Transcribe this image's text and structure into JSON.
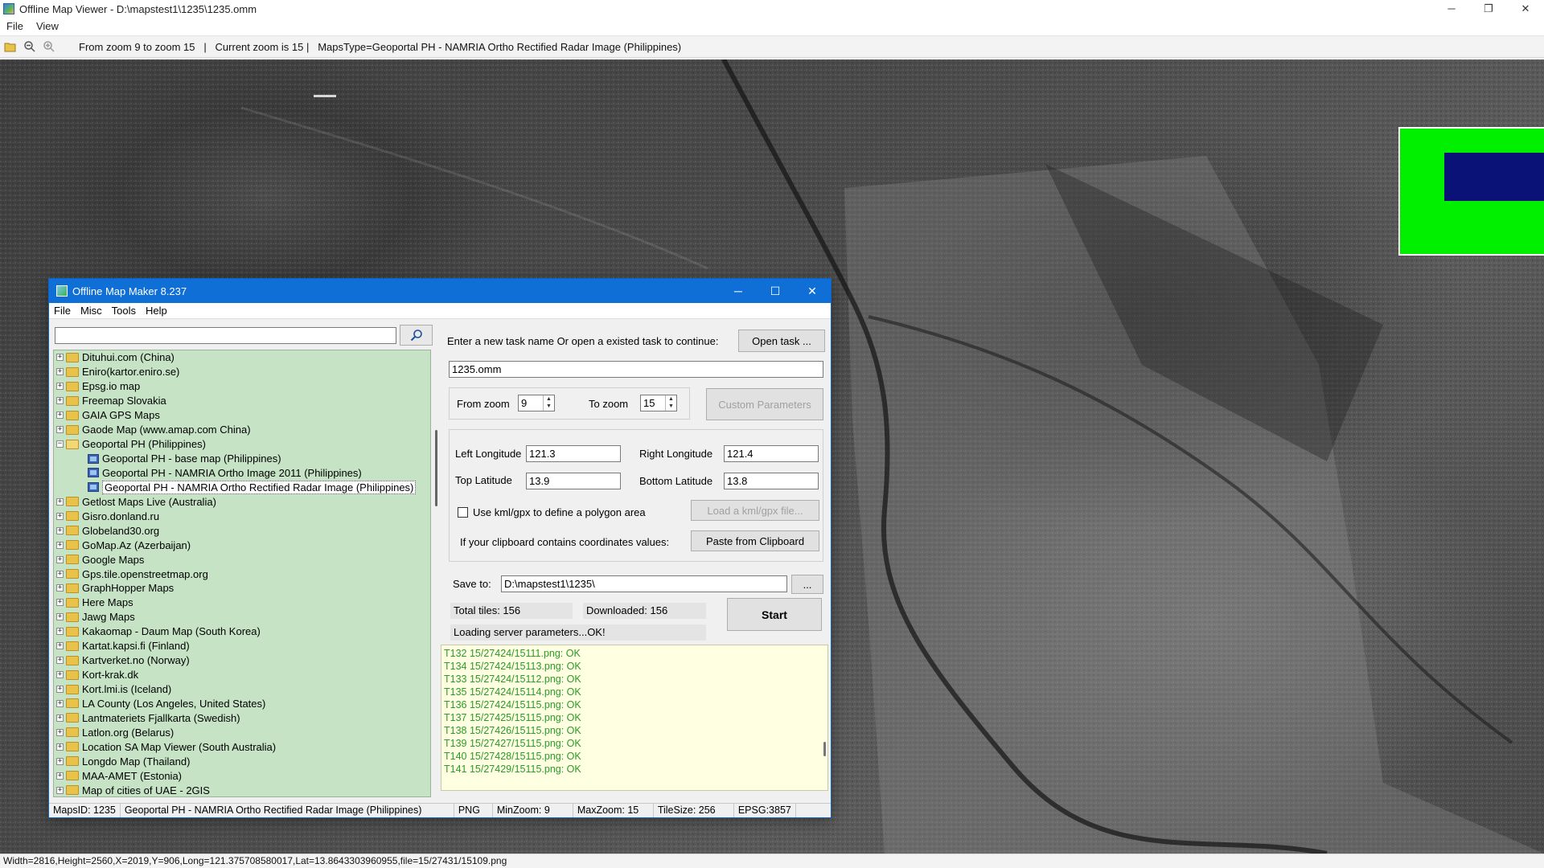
{
  "window": {
    "title": "Offline Map Viewer - D:\\mapstest1\\1235\\1235.omm",
    "controls": {
      "minimize": "─",
      "restore": "❐",
      "close": "✕"
    }
  },
  "menubar": [
    "File",
    "View"
  ],
  "toolbar": {
    "info": "From zoom 9 to zoom 15   |   Current zoom is 15 |   MapsType=Geoportal PH - NAMRIA Ortho Rectified Radar Image (Philippines)"
  },
  "statusbar": "Width=2816,Height=2560,X=2019,Y=906,Long=121.375708580017,Lat=13.8643303960955,file=15/27431/15109.png",
  "dialog": {
    "title": "Offline Map Maker 8.237",
    "controls": {
      "minimize": "─",
      "maximize": "☐",
      "close": "✕"
    },
    "menu": [
      "File",
      "Misc",
      "Tools",
      "Help"
    ],
    "search": {
      "value": "",
      "placeholder": ""
    },
    "tree": [
      {
        "label": "Dituhui.com (China)",
        "level": 0,
        "expanded": false
      },
      {
        "label": "Eniro(kartor.eniro.se)",
        "level": 0,
        "expanded": false
      },
      {
        "label": "Epsg.io map",
        "level": 0,
        "expanded": false
      },
      {
        "label": "Freemap Slovakia",
        "level": 0,
        "expanded": false
      },
      {
        "label": "GAIA GPS Maps",
        "level": 0,
        "expanded": false
      },
      {
        "label": "Gaode Map (www.amap.com China)",
        "level": 0,
        "expanded": false
      },
      {
        "label": "Geoportal PH (Philippines)",
        "level": 0,
        "expanded": true
      },
      {
        "label": "Geoportal PH - base map (Philippines)",
        "level": 1
      },
      {
        "label": "Geoportal PH - NAMRIA Ortho Image 2011 (Philippines)",
        "level": 1
      },
      {
        "label": "Geoportal PH - NAMRIA Ortho Rectified Radar Image (Philippines)",
        "level": 1,
        "selected": true
      },
      {
        "label": "Getlost Maps Live (Australia)",
        "level": 0,
        "expanded": false
      },
      {
        "label": "Gisro.donland.ru",
        "level": 0,
        "expanded": false
      },
      {
        "label": "Globeland30.org",
        "level": 0,
        "expanded": false
      },
      {
        "label": "GoMap.Az (Azerbaijan)",
        "level": 0,
        "expanded": false
      },
      {
        "label": "Google Maps",
        "level": 0,
        "expanded": false
      },
      {
        "label": "Gps.tile.openstreetmap.org",
        "level": 0,
        "expanded": false
      },
      {
        "label": "GraphHopper Maps",
        "level": 0,
        "expanded": false
      },
      {
        "label": "Here Maps",
        "level": 0,
        "expanded": false
      },
      {
        "label": "Jawg Maps",
        "level": 0,
        "expanded": false
      },
      {
        "label": "Kakaomap - Daum Map (South Korea)",
        "level": 0,
        "expanded": false
      },
      {
        "label": "Kartat.kapsi.fi (Finland)",
        "level": 0,
        "expanded": false
      },
      {
        "label": "Kartverket.no (Norway)",
        "level": 0,
        "expanded": false
      },
      {
        "label": "Kort-krak.dk",
        "level": 0,
        "expanded": false
      },
      {
        "label": "Kort.lmi.is (Iceland)",
        "level": 0,
        "expanded": false
      },
      {
        "label": "LA County (Los Angeles, United States)",
        "level": 0,
        "expanded": false
      },
      {
        "label": "Lantmateriets Fjallkarta (Swedish)",
        "level": 0,
        "expanded": false
      },
      {
        "label": "Latlon.org (Belarus)",
        "level": 0,
        "expanded": false
      },
      {
        "label": "Location SA Map Viewer (South Australia)",
        "level": 0,
        "expanded": false
      },
      {
        "label": "Longdo Map (Thailand)",
        "level": 0,
        "expanded": false
      },
      {
        "label": "MAA-AMET (Estonia)",
        "level": 0,
        "expanded": false
      },
      {
        "label": "Map of cities of UAE - 2GIS",
        "level": 0,
        "expanded": false
      }
    ],
    "task": {
      "prompt": "Enter a new task name Or open a existed task to continue:",
      "open_button": "Open task ...",
      "name_value": "1235.omm"
    },
    "zoom": {
      "from_label": "From zoom",
      "from_value": "9",
      "to_label": "To zoom",
      "to_value": "15",
      "custom_button": "Custom Parameters"
    },
    "coords": {
      "left_lon_label": "Left Longitude",
      "left_lon_value": "121.3",
      "right_lon_label": "Right Longitude",
      "right_lon_value": "121.4",
      "top_lat_label": "Top Latitude",
      "top_lat_value": "13.9",
      "bottom_lat_label": "Bottom Latitude",
      "bottom_lat_value": "13.8",
      "kml_checkbox_label": "Use kml/gpx to define a polygon area",
      "kml_checked": false,
      "load_kml_button": "Load a kml/gpx file...",
      "clipboard_label": "If your clipboard contains coordinates values:",
      "paste_button": "Paste from Clipboard"
    },
    "save": {
      "label": "Save to:",
      "value": "D:\\mapstest1\\1235\\",
      "browse_button": "..."
    },
    "progress": {
      "total_tiles": "Total tiles: 156",
      "downloaded": "Downloaded: 156",
      "status": "Loading server parameters...OK!",
      "start_button": "Start"
    },
    "log": [
      "T132 15/27424/15111.png: OK",
      "T134 15/27424/15113.png: OK",
      "T133 15/27424/15112.png: OK",
      "T135 15/27424/15114.png: OK",
      "T136 15/27424/15115.png: OK",
      "T137 15/27425/15115.png: OK",
      "T138 15/27426/15115.png: OK",
      "T139 15/27427/15115.png: OK",
      "T140 15/27428/15115.png: OK",
      "T141 15/27429/15115.png: OK"
    ],
    "status": {
      "maps_id": "MapsID: 1235",
      "maps_name": "Geoportal PH - NAMRIA Ortho Rectified Radar Image (Philippines)",
      "format": "PNG",
      "min_zoom": "MinZoom: 9",
      "max_zoom": "MaxZoom: 15",
      "tile_size": "TileSize: 256",
      "epsg": "EPSG:3857"
    }
  },
  "colors": {
    "dialog_titlebar": "#0f6fd6",
    "tree_background": "#c6e3c6",
    "log_background": "#ffffe1",
    "log_text": "#2a9a2a",
    "minimap_background": "#00f000",
    "minimap_viewport": "#0a1278"
  }
}
